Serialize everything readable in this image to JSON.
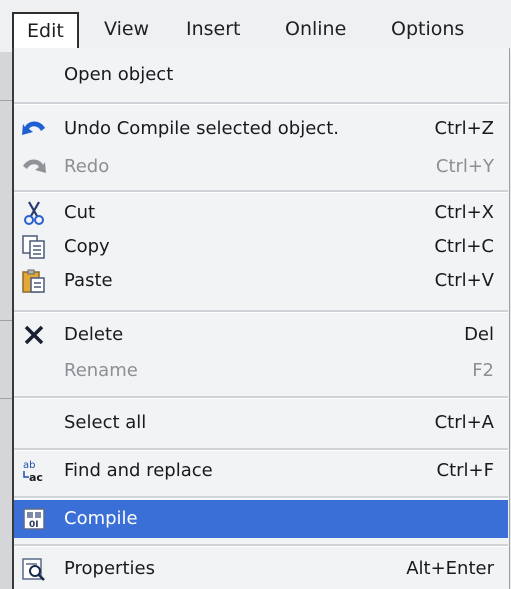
{
  "menubar": {
    "items": [
      {
        "label": "Edit"
      },
      {
        "label": "View"
      },
      {
        "label": "Insert"
      },
      {
        "label": "Online"
      },
      {
        "label": "Options"
      }
    ]
  },
  "menu": {
    "items": [
      {
        "label": "Open object",
        "shortcut": ""
      },
      {
        "label": "Undo Compile selected object.",
        "shortcut": "Ctrl+Z"
      },
      {
        "label": "Redo",
        "shortcut": "Ctrl+Y"
      },
      {
        "label": "Cut",
        "shortcut": "Ctrl+X"
      },
      {
        "label": "Copy",
        "shortcut": "Ctrl+C"
      },
      {
        "label": "Paste",
        "shortcut": "Ctrl+V"
      },
      {
        "label": "Delete",
        "shortcut": "Del"
      },
      {
        "label": "Rename",
        "shortcut": "F2"
      },
      {
        "label": "Select all",
        "shortcut": "Ctrl+A"
      },
      {
        "label": "Find and replace",
        "shortcut": "Ctrl+F"
      },
      {
        "label": "Compile",
        "shortcut": ""
      },
      {
        "label": "Properties",
        "shortcut": "Alt+Enter"
      }
    ],
    "find_icon_text": {
      "top": "ab",
      "bottom": "ac"
    }
  },
  "colors": {
    "highlight": "#3a6fd8",
    "disabled_text": "#8c8f94",
    "undo_icon": "#1e5fd1"
  }
}
